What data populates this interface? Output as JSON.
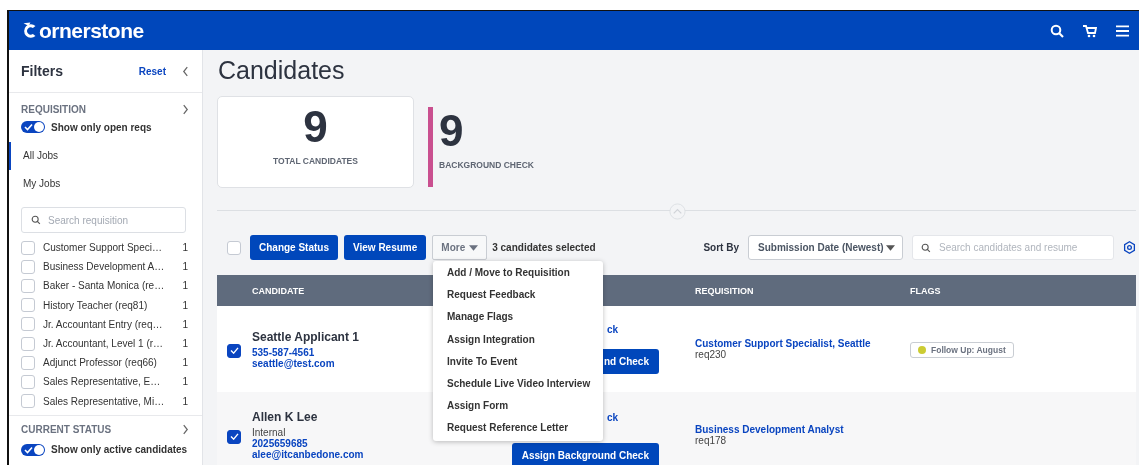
{
  "header": {
    "logo_text": "ornerstone"
  },
  "filters": {
    "title": "Filters",
    "reset": "Reset",
    "requisition": {
      "title": "REQUISITION",
      "toggle": {
        "label": "Show only open reqs",
        "on": true
      },
      "views": [
        {
          "label": "All Jobs",
          "selected": true
        },
        {
          "label": "My Jobs",
          "selected": false
        }
      ],
      "search_placeholder": "Search requisition",
      "items": [
        {
          "label": "Customer Support Speci…",
          "count": "1",
          "checked": false
        },
        {
          "label": "Business Development A…",
          "count": "1",
          "checked": false
        },
        {
          "label": "Baker - Santa Monica (re…",
          "count": "1",
          "checked": false
        },
        {
          "label": "History Teacher (req81)",
          "count": "1",
          "checked": false
        },
        {
          "label": "Jr. Accountant Entry (req…",
          "count": "1",
          "checked": false
        },
        {
          "label": "Jr. Accountant, Level 1 (r…",
          "count": "1",
          "checked": false
        },
        {
          "label": "Adjunct Professor (req66)",
          "count": "1",
          "checked": false
        },
        {
          "label": "Sales Representative, E…",
          "count": "1",
          "checked": false
        },
        {
          "label": "Sales Representative, Mi…",
          "count": "1",
          "checked": false
        }
      ]
    },
    "current_status": {
      "title": "CURRENT STATUS",
      "toggle": {
        "label": "Show only active candidates",
        "on": true
      }
    }
  },
  "page_title": "Candidates",
  "stats": [
    {
      "kind": "card",
      "value": "9",
      "label": "TOTAL CANDIDATES"
    },
    {
      "kind": "bar",
      "value": "9",
      "label": "BACKGROUND CHECK"
    }
  ],
  "toolbar": {
    "select_all_checked": false,
    "buttons": [
      "Change Status",
      "View Resume"
    ],
    "more": "More",
    "selection_count": "3 candidates selected",
    "sort_label": "Sort By",
    "sort_value": "Submission Date (Newest)",
    "search_placeholder": "Search candidates and resume"
  },
  "table": {
    "columns": [
      "CANDIDATE",
      "REQUISITION",
      "FLAGS"
    ],
    "rows": [
      {
        "checked": true,
        "name": "Seattle Applicant 1",
        "phone": "535-587-4561",
        "email": "seattle@test.com",
        "action_link": "ck",
        "action_button": "nd Check",
        "requisition": "Customer Support Specialist, Seattle",
        "req_id": "req230",
        "flags": [
          {
            "label": "Follow Up: August",
            "color": "#cccc33"
          }
        ]
      },
      {
        "checked": true,
        "name": "Allen K Lee",
        "source": "Internal",
        "phone": "2025659685",
        "email": "alee@itcanbedone.com",
        "action_link": "ck",
        "action_button": "Assign Background Check",
        "requisition": "Business Development Analyst",
        "req_id": "req178",
        "flags": []
      }
    ]
  },
  "more_menu": {
    "items": [
      "Add / Move to Requisition",
      "Request Feedback",
      "Manage Flags",
      "Assign Integration",
      "Invite To Event",
      "Schedule Live Video Interview",
      "Assign Form",
      "Request Reference Letter"
    ]
  }
}
